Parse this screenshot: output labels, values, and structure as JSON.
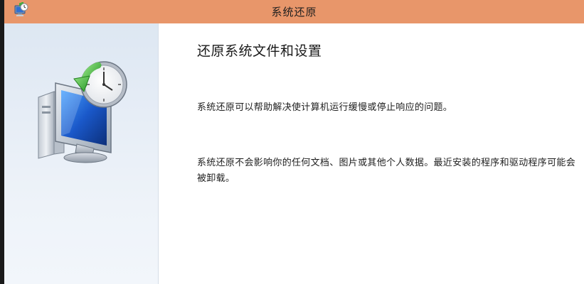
{
  "window": {
    "title": "系统还原"
  },
  "icons": {
    "app": "system-restore-icon",
    "hero": "computer-clock-restore-icon"
  },
  "colors": {
    "titlebar": "#e8966a",
    "side_panel": "#e4ecf5",
    "text": "#1e1e1e"
  },
  "main": {
    "heading": "还原系统文件和设置",
    "paragraph1": "系统还原可以帮助解决使计算机运行缓慢或停止响应的问题。",
    "paragraph2": "系统还原不会影响你的任何文档、图片或其他个人数据。最近安装的程序和驱动程序可能会被卸载。"
  }
}
